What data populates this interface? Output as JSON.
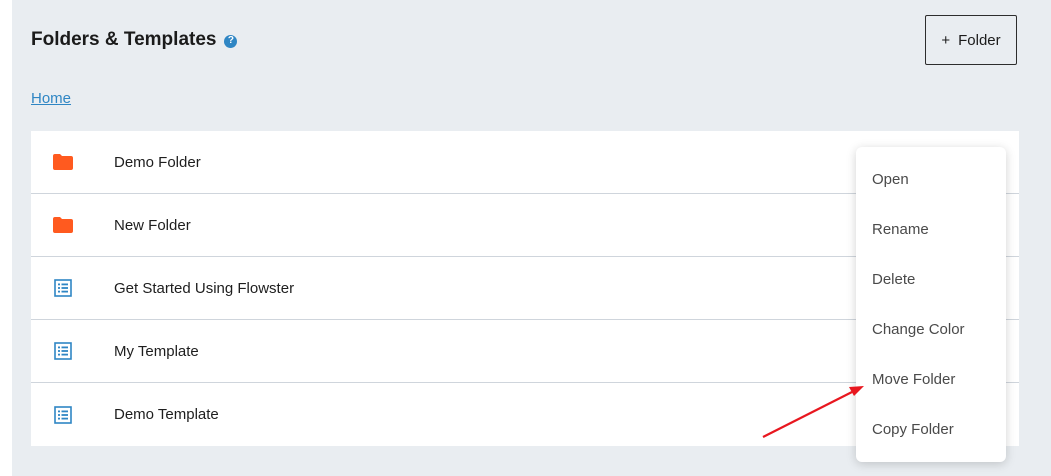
{
  "header": {
    "title": "Folders & Templates",
    "help_icon": "question-circle-icon",
    "add_folder_plus": "+",
    "add_folder_label": "Folder"
  },
  "breadcrumb": {
    "home": "Home"
  },
  "items": [
    {
      "label": "Demo Folder",
      "icon": "folder-icon",
      "color": "#ff5a1f"
    },
    {
      "label": "New Folder",
      "icon": "folder-icon",
      "color": "#ff5a1f"
    },
    {
      "label": "Get Started Using Flowster",
      "icon": "template-list-icon",
      "color": "#2f86c4"
    },
    {
      "label": "My Template",
      "icon": "template-list-icon",
      "color": "#2f86c4"
    },
    {
      "label": "Demo Template",
      "icon": "template-list-icon",
      "color": "#2f86c4"
    }
  ],
  "context_menu": {
    "open": "Open",
    "rename": "Rename",
    "delete": "Delete",
    "change_color": "Change Color",
    "move_folder": "Move Folder",
    "copy_folder": "Copy Folder"
  },
  "colors": {
    "panel_background": "#e9edf1",
    "accent_blue": "#2f86c4",
    "folder_orange": "#ff5a1f",
    "annotation_arrow_red": "#e8171f"
  }
}
